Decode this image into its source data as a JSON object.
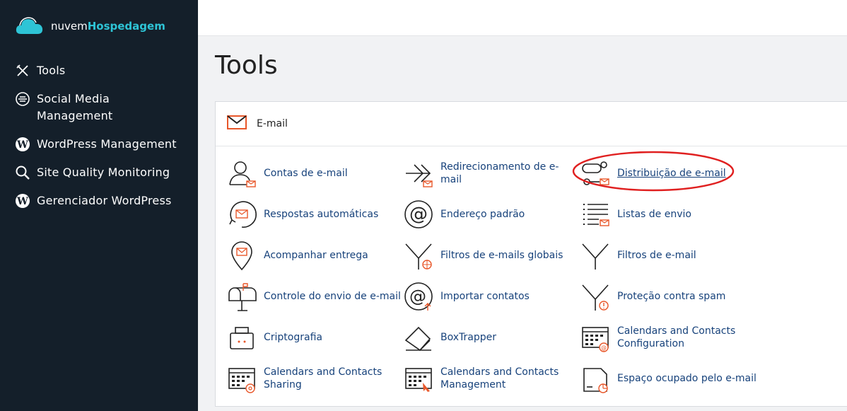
{
  "brand": {
    "prefix": "nuvem",
    "name": "Hospedagem",
    "accent": "#2ec4d6"
  },
  "sidebar": {
    "items": [
      {
        "label": "Tools",
        "icon": "tools-icon"
      },
      {
        "label": "Social Media Management",
        "icon": "social-media-icon"
      },
      {
        "label": "WordPress Management",
        "icon": "wordpress-icon"
      },
      {
        "label": "Site Quality Monitoring",
        "icon": "magnifier-icon"
      },
      {
        "label": "Gerenciador WordPress",
        "icon": "wordpress-icon"
      }
    ]
  },
  "page": {
    "title": "Tools"
  },
  "panel": {
    "title": "E-mail",
    "icon": "envelope-icon",
    "tools": [
      {
        "label": "Contas de e-mail",
        "icon": "email-accounts-icon"
      },
      {
        "label": "Redirecionamento de e-mail",
        "icon": "forwarders-icon"
      },
      {
        "label": "Distribuição de e-mail",
        "icon": "email-routing-icon"
      },
      {
        "label": "Respostas automáticas",
        "icon": "autoresponders-icon"
      },
      {
        "label": "Endereço padrão",
        "icon": "at-sign-icon"
      },
      {
        "label": "Listas de envio",
        "icon": "mailing-lists-icon"
      },
      {
        "label": "Acompanhar entrega",
        "icon": "track-delivery-icon"
      },
      {
        "label": "Filtros de e-mails globais",
        "icon": "global-filter-icon"
      },
      {
        "label": "Filtros de e-mail",
        "icon": "filter-icon"
      },
      {
        "label": "Controle do envio de e-mail",
        "icon": "mailbox-icon"
      },
      {
        "label": "Importar contatos",
        "icon": "import-contacts-icon"
      },
      {
        "label": "Proteção contra spam",
        "icon": "spam-protection-icon"
      },
      {
        "label": "Criptografia",
        "icon": "encryption-icon"
      },
      {
        "label": "BoxTrapper",
        "icon": "boxtrapper-icon"
      },
      {
        "label": "Calendars and Contacts Configuration",
        "icon": "calendar-config-icon"
      },
      {
        "label": "Calendars and Contacts Sharing",
        "icon": "calendar-sharing-icon"
      },
      {
        "label": "Calendars and Contacts Management",
        "icon": "calendar-management-icon"
      },
      {
        "label": "Espaço ocupado pelo e-mail",
        "icon": "disk-usage-icon"
      }
    ]
  },
  "colors": {
    "sidebar_bg": "#141f2a",
    "link": "#17427b",
    "accent_orange": "#e8572a",
    "highlight": "#e02020"
  }
}
